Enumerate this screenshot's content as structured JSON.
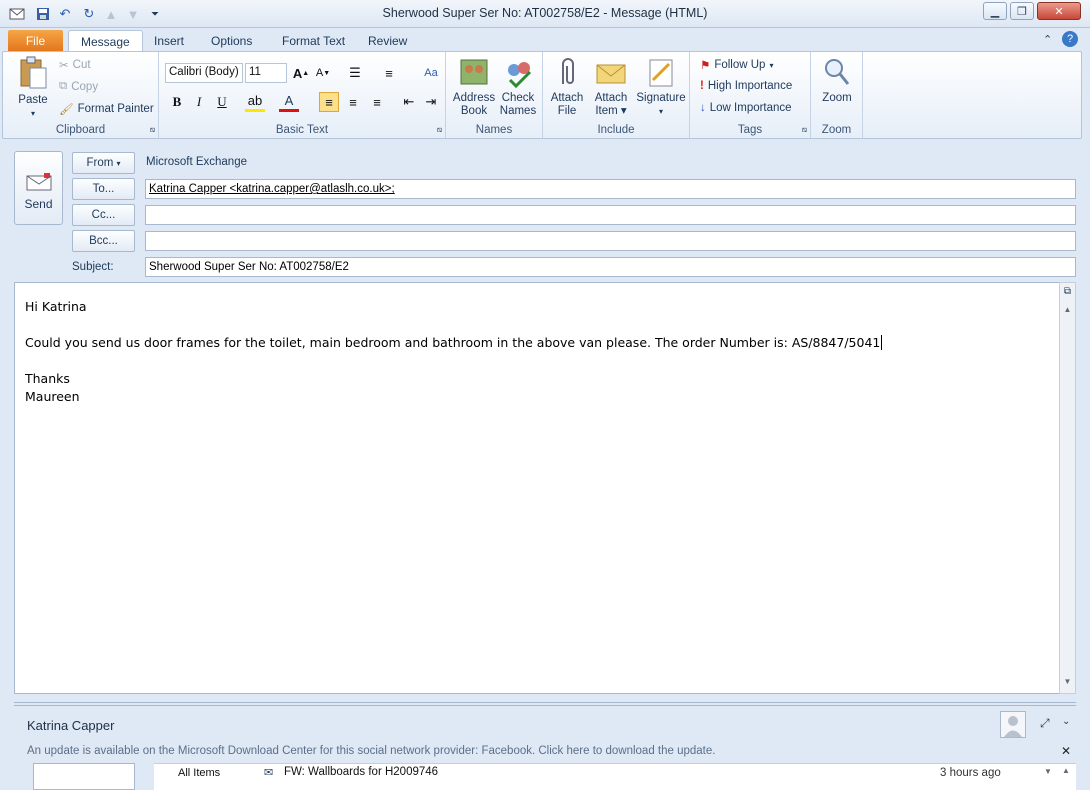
{
  "window": {
    "title": "Sherwood Super Ser No:    AT002758/E2  -  Message (HTML)"
  },
  "tabs": [
    {
      "label": "File"
    },
    {
      "label": "Message"
    },
    {
      "label": "Insert"
    },
    {
      "label": "Options"
    },
    {
      "label": "Format Text"
    },
    {
      "label": "Review"
    }
  ],
  "ribbon": {
    "clipboard": {
      "paste": "Paste",
      "cut": "Cut",
      "copy": "Copy",
      "format_painter": "Format Painter",
      "group": "Clipboard"
    },
    "basic_text": {
      "font": "Calibri (Body)",
      "size": "11",
      "group": "Basic Text"
    },
    "names": {
      "address_book_1": "Address",
      "address_book_2": "Book",
      "check_names_1": "Check",
      "check_names_2": "Names",
      "group": "Names"
    },
    "include": {
      "attach_file_1": "Attach",
      "attach_file_2": "File",
      "attach_item_1": "Attach",
      "attach_item_2": "Item",
      "signature": "Signature",
      "group": "Include"
    },
    "tags": {
      "follow_up": "Follow Up",
      "high_importance": "High Importance",
      "low_importance": "Low Importance",
      "group": "Tags"
    },
    "zoom": {
      "zoom": "Zoom",
      "group": "Zoom"
    }
  },
  "compose": {
    "send": "Send",
    "from_btn": "From",
    "from_value": "Microsoft Exchange",
    "to_btn": "To...",
    "to_value": "Katrina Capper <katrina.capper@atlaslh.co.uk>;",
    "cc_btn": "Cc...",
    "cc_value": "",
    "bcc_btn": "Bcc...",
    "bcc_value": "",
    "subject_label": "Subject:",
    "subject_value": "Sherwood Super Ser No:    AT002758/E2"
  },
  "body": {
    "greeting": "Hi Katrina",
    "paragraph": "Could you send us door frames for the toilet, main bedroom and bathroom in the above van please.  The order Number is:  AS/8847/5041",
    "closing": "Thanks",
    "signature": "Maureen"
  },
  "people_pane": {
    "name": "Katrina Capper",
    "update_notice": "An update is available on the Microsoft Download Center for this social network provider: Facebook. Click here to download the update.",
    "filter": "All Items",
    "item_subject": "FW: Wallboards for H2009746",
    "item_time": "3 hours ago"
  },
  "colors": {
    "file_tab": "#e3751c",
    "ribbon_bg": "#dfe9f5",
    "accent": "#1e395b"
  }
}
